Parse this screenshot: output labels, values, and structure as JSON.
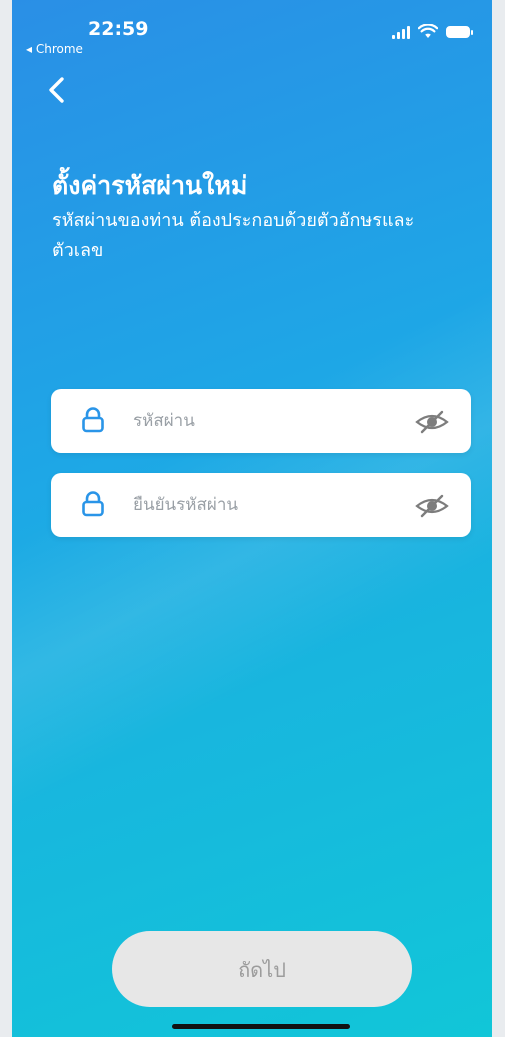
{
  "status_bar": {
    "time": "22:59",
    "back_app": "◂ Chrome"
  },
  "header": {
    "title": "ตั้งค่ารหัสผ่านใหม่",
    "subtitle": "รหัสผ่านของท่าน ต้องประกอบด้วยตัวอักษรและตัวเลข"
  },
  "form": {
    "password": {
      "placeholder": "รหัสผ่าน",
      "value": ""
    },
    "confirm_password": {
      "placeholder": "ยืนยันรหัสผ่าน",
      "value": ""
    }
  },
  "next_button": {
    "label": "ถัดไป"
  },
  "colors": {
    "gradient_start": "#2a8fe6",
    "gradient_end": "#11c6d8",
    "icon_accent": "#2a95e8",
    "button_disabled_bg": "#e7e7e7",
    "button_disabled_text": "#9c9c9c"
  },
  "icons": {
    "back": "chevron-left-icon",
    "field": "lock-icon",
    "visibility": "eye-slash-icon"
  }
}
